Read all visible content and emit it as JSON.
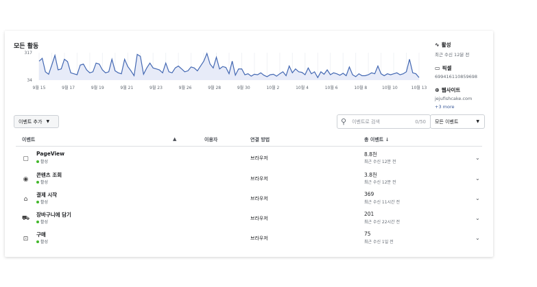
{
  "panel": {
    "title": "모든 활동"
  },
  "chart_data": {
    "type": "line",
    "y_ticks": [
      "317",
      "34"
    ],
    "ylim": [
      34,
      317
    ],
    "x_labels": [
      "9월 15",
      "9월 17",
      "9월 19",
      "9월 21",
      "9월 23",
      "9월 26",
      "9월 28",
      "9월 30",
      "10월 2",
      "10월 4",
      "10월 6",
      "10월 8",
      "10월 10",
      "10월 13"
    ],
    "values": [
      230,
      260,
      120,
      95,
      190,
      290,
      140,
      150,
      250,
      225,
      110,
      100,
      90,
      190,
      200,
      140,
      110,
      120,
      210,
      200,
      140,
      110,
      120,
      250,
      130,
      110,
      100,
      250,
      175,
      130,
      80,
      300,
      280,
      95,
      160,
      210,
      160,
      150,
      140,
      110,
      210,
      120,
      110,
      160,
      180,
      150,
      120,
      130,
      170,
      160,
      130,
      180,
      230,
      310,
      200,
      160,
      270,
      150,
      175,
      165,
      100,
      230,
      85,
      150,
      150,
      90,
      100,
      75,
      95,
      90,
      110,
      85,
      70,
      90,
      95,
      75,
      100,
      120,
      80,
      180,
      110,
      150,
      120,
      115,
      90,
      160,
      100,
      120,
      60,
      120,
      95,
      140,
      90,
      110,
      100,
      85,
      105,
      80,
      170,
      90,
      70,
      100,
      80,
      80,
      90,
      110,
      100,
      180,
      100,
      80,
      100,
      90,
      100,
      110,
      90,
      100,
      120,
      250,
      110,
      100,
      60
    ],
    "color": "#4267b2",
    "fill": "#e7ebf8"
  },
  "side_info": {
    "activity": {
      "label": "활성",
      "sub": "최근 수신 12분 전",
      "icon": "pulse-icon"
    },
    "pixel": {
      "label": "픽셀",
      "sub": "699416110859698",
      "icon": "laptop-icon"
    },
    "website": {
      "label": "웹사이트",
      "sub": "jejufishcake.com",
      "more": "+3 more",
      "icon": "globe-icon"
    }
  },
  "toolbar": {
    "add_event": "이벤트 추가",
    "search_placeholder": "이벤트로 검색",
    "search_count": "0/50",
    "filter": "모든 이벤트"
  },
  "table": {
    "headers": {
      "event": "이벤트",
      "warning": "▲",
      "users": "이용자",
      "connection": "연결 방법",
      "total": "총 이벤트 ↓"
    },
    "rows": [
      {
        "icon": "▢",
        "name": "PageView",
        "status": "활성",
        "connection": "브라우저",
        "total": "8.8천",
        "time": "최근 수신 12분 전"
      },
      {
        "icon": "◉",
        "name": "콘텐츠 조회",
        "status": "활성",
        "connection": "브라우저",
        "total": "3.8천",
        "time": "최근 수신 12분 전"
      },
      {
        "icon": "⌂",
        "name": "결제 시작",
        "status": "활성",
        "connection": "브라우저",
        "total": "369",
        "time": "최근 수신 11시간 전"
      },
      {
        "icon": "⛟",
        "name": "장바구니에 담기",
        "status": "활성",
        "connection": "브라우저",
        "total": "201",
        "time": "최근 수신 22시간 전"
      },
      {
        "icon": "⊡",
        "name": "구매",
        "status": "활성",
        "connection": "브라우저",
        "total": "75",
        "time": "최근 수신 1일 전"
      }
    ]
  }
}
